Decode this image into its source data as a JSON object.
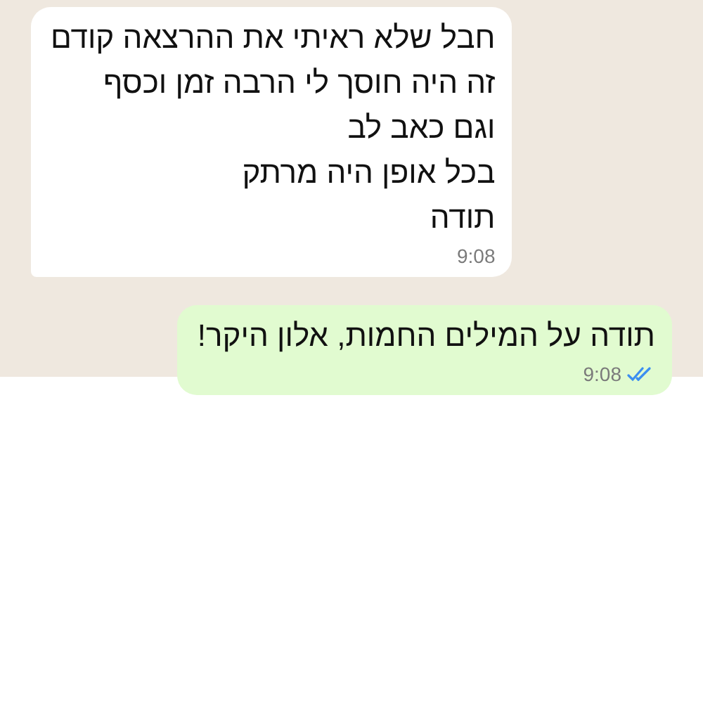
{
  "messages": [
    {
      "kind": "incoming",
      "lines": [
        "חבל שלא ראיתי את ההרצאה קודם",
        "זה היה חוסך לי הרבה זמן וכסף",
        "וגם כאב לב",
        "בכל אופן היה מרתק",
        "תודה"
      ],
      "time": "9:08"
    },
    {
      "kind": "outgoing",
      "lines": [
        "תודה על המילים החמות, אלון היקר!"
      ],
      "time": "9:08",
      "read": true
    }
  ]
}
